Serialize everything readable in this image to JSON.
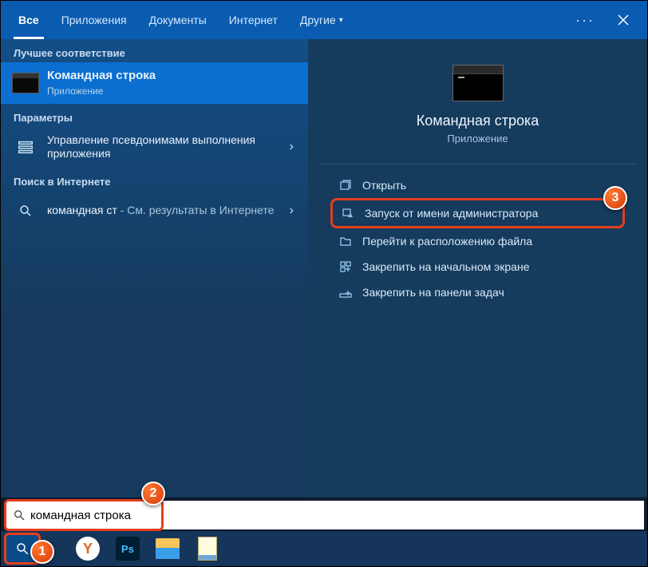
{
  "tabs": {
    "all": "Все",
    "apps": "Приложения",
    "docs": "Документы",
    "web": "Интернет",
    "more": "Другие"
  },
  "left": {
    "best_match_label": "Лучшее соответствие",
    "best_match": {
      "title": "Командная строка",
      "sub": "Приложение"
    },
    "settings_label": "Параметры",
    "settings_item": "Управление псевдонимами выполнения приложения",
    "web_label": "Поиск в Интернете",
    "web_item_query": "командная ст",
    "web_item_suffix": " - См. результаты в Интернете"
  },
  "preview": {
    "title": "Командная строка",
    "sub": "Приложение",
    "actions": {
      "open": "Открыть",
      "run_admin": "Запуск от имени администратора",
      "open_location": "Перейти к расположению файла",
      "pin_start": "Закрепить на начальном экране",
      "pin_taskbar": "Закрепить на панели задач"
    }
  },
  "search": {
    "value": "командная строка"
  },
  "badges": {
    "b1": "1",
    "b2": "2",
    "b3": "3"
  }
}
